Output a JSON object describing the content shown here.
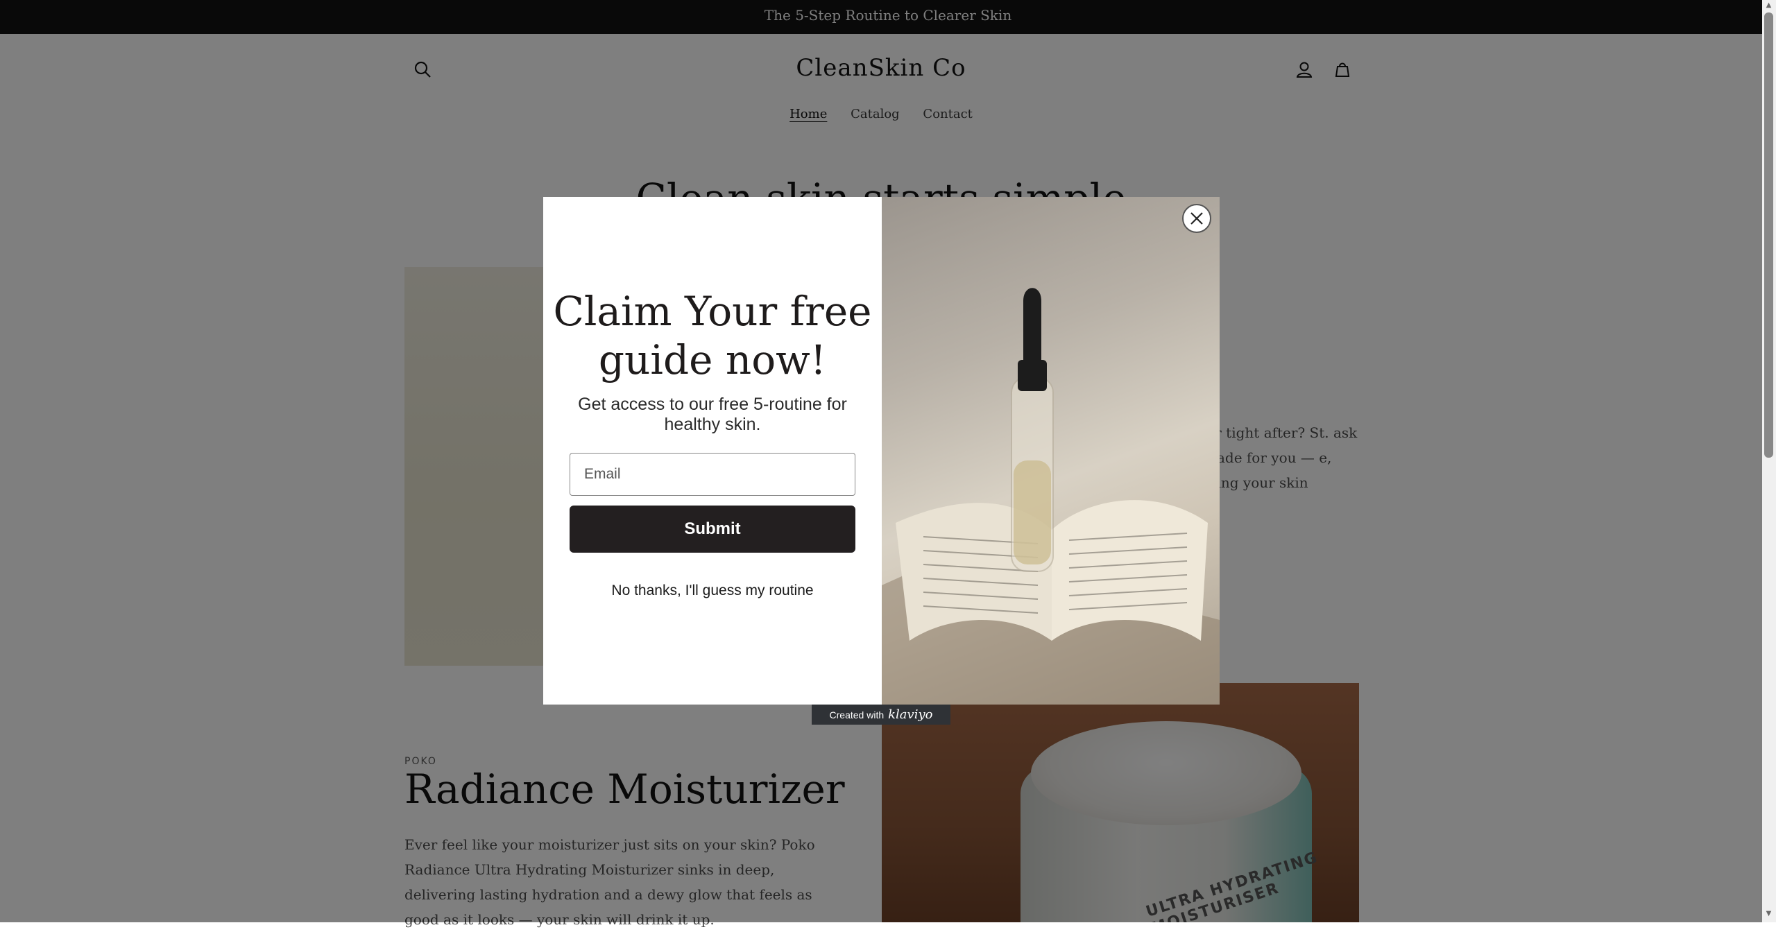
{
  "announcement": "The 5-Step Routine to Clearer Skin",
  "header": {
    "logo": "CleanSkin Co",
    "nav": [
      "Home",
      "Catalog",
      "Contact"
    ]
  },
  "hero": {
    "title": "Clean skin starts simple"
  },
  "feature1": {
    "desc_visible": "ry or tight after? St. ask is made for you — e, leaving your skin"
  },
  "product": {
    "brand": "POKO",
    "title": "Radiance Moisturizer",
    "description": "Ever feel like your moisturizer just sits on your skin? Poko Radiance Ultra Hydrating Moisturizer sinks in deep, delivering lasting hydration and a dewy glow that feels as good as it looks — your skin will drink it up.",
    "jar_label": "ULTRA HYDRATING MOISTURISER"
  },
  "modal": {
    "title": "Claim Your free guide now!",
    "subtitle": "Get access to our free 5-routine for healthy skin.",
    "email_placeholder": "Email",
    "submit_label": "Submit",
    "decline_label": "No thanks, I'll guess my routine",
    "badge_prefix": "Created with",
    "badge_brand": "klaviyo"
  },
  "icons": {
    "search": "search-icon",
    "account": "account-icon",
    "cart": "cart-icon",
    "close": "close-icon"
  },
  "colors": {
    "announcement_bg": "#121212",
    "submit_bg": "#231f20",
    "overlay": "rgba(0,0,0,0.5)",
    "badge_bg": "#2f3236"
  }
}
